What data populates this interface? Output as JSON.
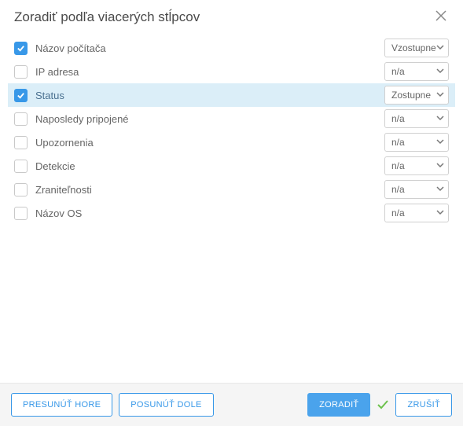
{
  "title": "Zoradiť podľa viacerých stĺpcov",
  "closeIcon": "close",
  "rows": [
    {
      "label": "Názov počítača",
      "checked": true,
      "selected": false,
      "value": "Vzostupne"
    },
    {
      "label": "IP adresa",
      "checked": false,
      "selected": false,
      "value": "n/a"
    },
    {
      "label": "Status",
      "checked": true,
      "selected": true,
      "value": "Zostupne"
    },
    {
      "label": "Naposledy pripojené",
      "checked": false,
      "selected": false,
      "value": "n/a"
    },
    {
      "label": "Upozornenia",
      "checked": false,
      "selected": false,
      "value": "n/a"
    },
    {
      "label": "Detekcie",
      "checked": false,
      "selected": false,
      "value": "n/a"
    },
    {
      "label": "Zraniteľnosti",
      "checked": false,
      "selected": false,
      "value": "n/a"
    },
    {
      "label": "Názov OS",
      "checked": false,
      "selected": false,
      "value": "n/a"
    }
  ],
  "buttons": {
    "moveUp": "PRESUNÚŤ HORE",
    "moveDown": "POSUNÚŤ DOLE",
    "sort": "ZORADIŤ",
    "cancel": "ZRUŠIŤ"
  }
}
